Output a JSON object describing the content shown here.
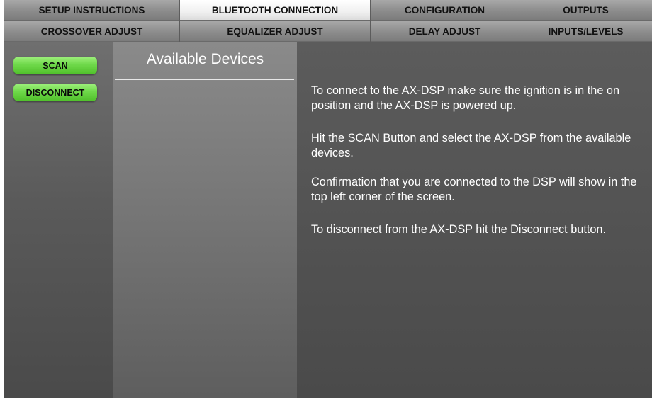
{
  "tabs": {
    "row1": [
      {
        "label": "SETUP INSTRUCTIONS",
        "active": false
      },
      {
        "label": "BLUETOOTH CONNECTION",
        "active": true
      },
      {
        "label": "CONFIGURATION",
        "active": false
      },
      {
        "label": "OUTPUTS",
        "active": false
      }
    ],
    "row2": [
      {
        "label": "CROSSOVER ADJUST",
        "active": false
      },
      {
        "label": "EQUALIZER ADJUST",
        "active": false
      },
      {
        "label": "DELAY ADJUST",
        "active": false
      },
      {
        "label": "INPUTS/LEVELS",
        "active": false
      }
    ]
  },
  "sidebar": {
    "scan_label": "SCAN",
    "disconnect_label": "DISCONNECT"
  },
  "devices": {
    "title": "Available Devices"
  },
  "instructions": [
    "To connect to the AX-DSP make sure the ignition is in the on position and the AX-DSP is powered up.",
    "Hit the SCAN Button and select the AX-DSP from the available devices.",
    "Confirmation that you are connected to the DSP will show in the top left corner of the screen.",
    "To disconnect from the AX-DSP hit the Disconnect button."
  ],
  "colors": {
    "button_green": "#6fd94a",
    "active_tab": "#f0f0f0",
    "inactive_tab": "#8c8c8c"
  }
}
